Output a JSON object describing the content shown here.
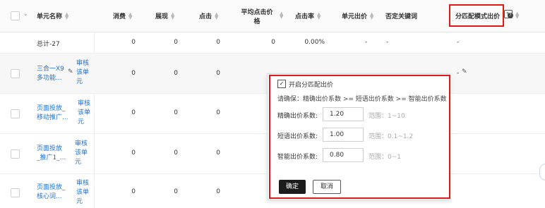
{
  "header": {
    "unit_name": "单元名称",
    "cost": "消费",
    "impressions": "展现",
    "clicks": "点击",
    "avg_cpc_line1": "平均点击价",
    "avg_cpc_line2": "格",
    "ctr": "点击率",
    "unit_bid": "单元出价",
    "negative_keywords": "否定关键词",
    "match_bid": "分匹配模式出价"
  },
  "total_row": {
    "name": "总计-27",
    "cost": "0",
    "impressions": "0",
    "clicks": "0",
    "avg_cpc": "0",
    "ctr": "0.00%",
    "unit_bid": "-",
    "negative_keywords": "-",
    "match_bid": "-"
  },
  "rows": [
    {
      "name_line1": "三合一X9",
      "name_line2": "多功能...",
      "status": [
        "审核",
        "该单",
        "元"
      ],
      "cost": "0",
      "impressions": "0",
      "clicks": "0",
      "match_bid": "-"
    },
    {
      "name_line1": "页面投放_",
      "name_line2": "移动推广...",
      "status": [
        "审核",
        "该单",
        "元"
      ],
      "cost": "0",
      "impressions": "0",
      "clicks": "0"
    },
    {
      "name_line1": "页面投放",
      "name_line2": "_推广1_...",
      "status": [
        "审核",
        "该单",
        "元"
      ],
      "cost": "0",
      "impressions": "0",
      "clicks": "0"
    },
    {
      "name_line1": "页面投放_",
      "name_line2": "核心词...",
      "status": [
        "审核",
        "该单",
        "元"
      ],
      "cost": "0",
      "impressions": "0",
      "clicks": "0"
    }
  ],
  "popup": {
    "enable_label": "开启分匹配出价",
    "enabled": true,
    "hint": "请确保：精确出价系数 >= 短语出价系数 >= 智能出价系数",
    "fields": [
      {
        "label": "精确出价系数:",
        "value": "1.20",
        "range": "范围：1~10"
      },
      {
        "label": "短语出价系数:",
        "value": "1.00",
        "range": "范围：0.1~1.2"
      },
      {
        "label": "智能出价系数:",
        "value": "0.80",
        "range": "范围：0~1"
      }
    ],
    "confirm": "确定",
    "cancel": "取消"
  },
  "colors": {
    "link": "#1f6fd1",
    "highlight": "#e01818",
    "primary_button": "#1c1c1c"
  },
  "icons": [
    "chevron-down-icon",
    "sort-icon",
    "edit-icon",
    "help-icon",
    "checkbox-checked-icon"
  ]
}
